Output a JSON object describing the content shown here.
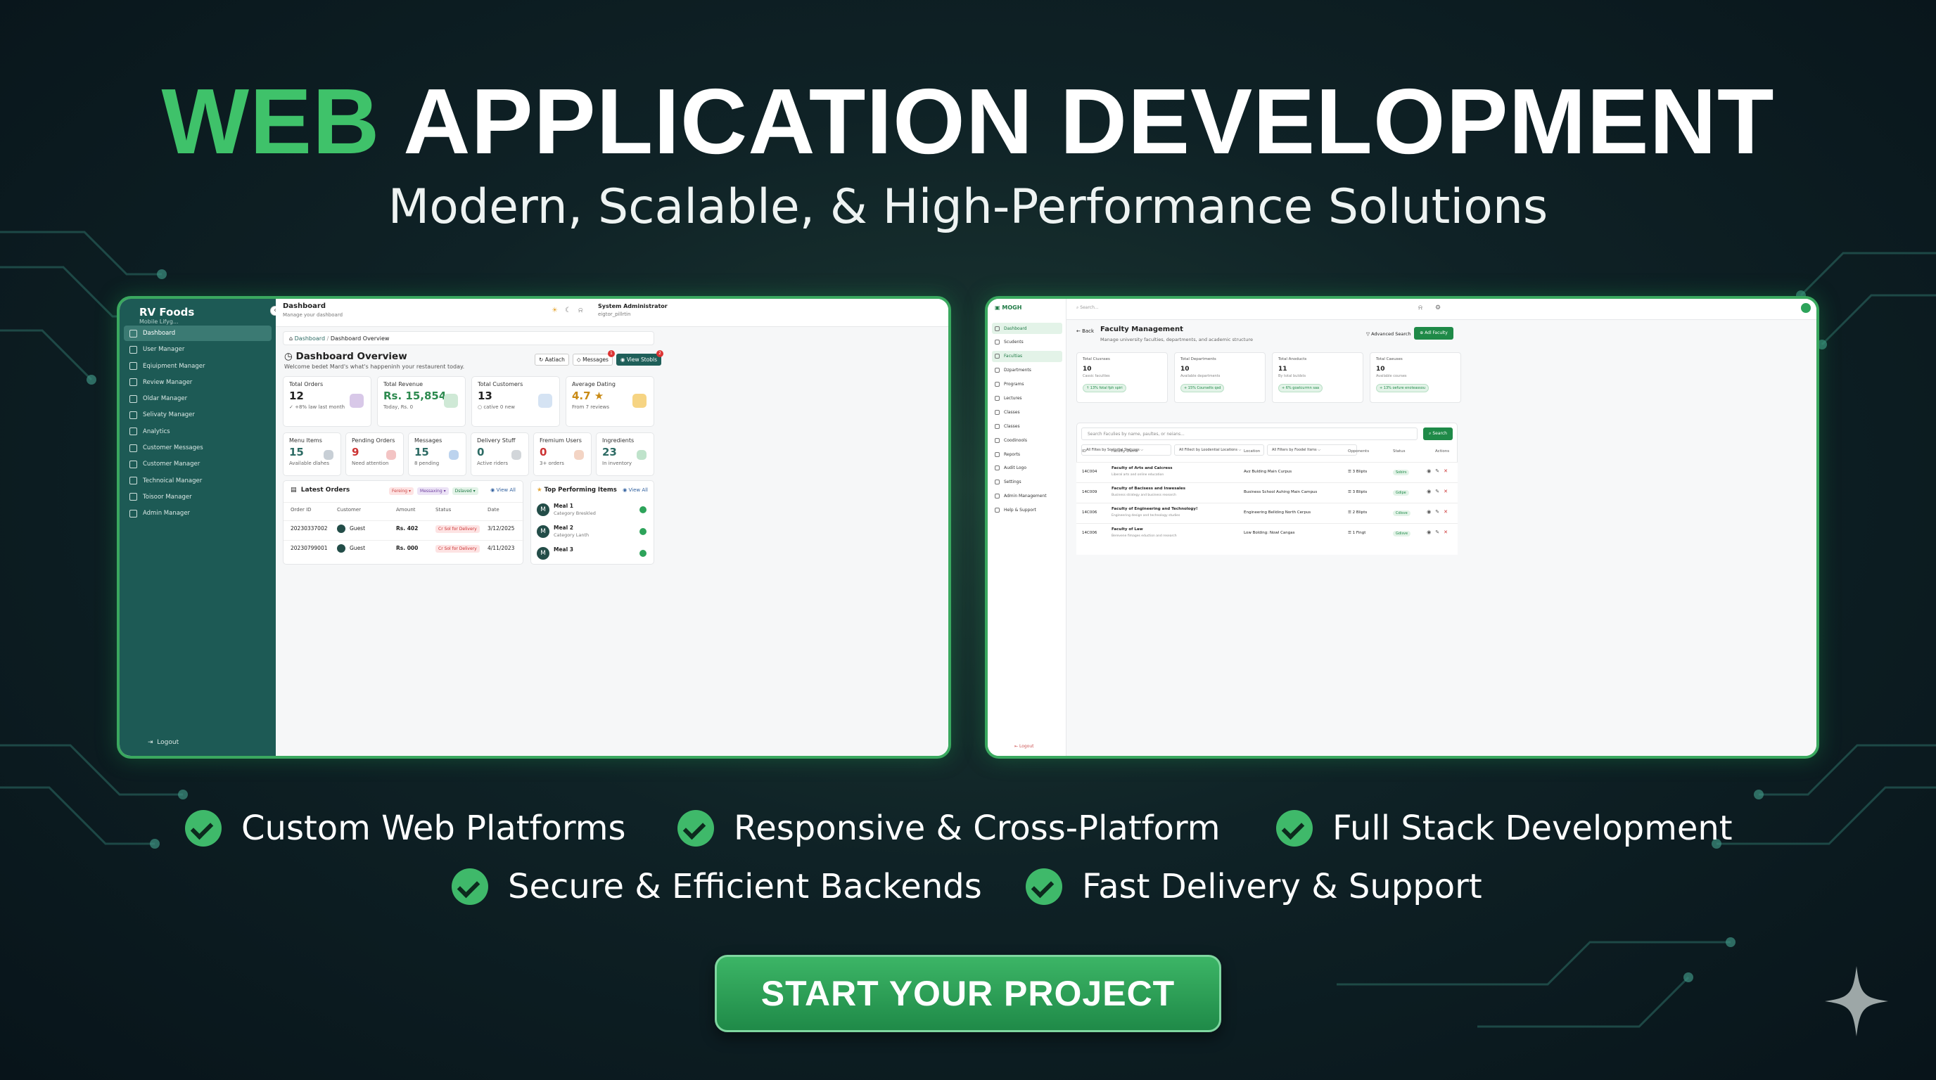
{
  "hero": {
    "title_green": "WEB",
    "title_white": "APPLICATION DEVELOPMENT",
    "subtitle": "Modern, Scalable, & High-Performance Solutions"
  },
  "dashboard": {
    "brand_name": "RV Foods",
    "brand_tag": "Mobile Lifyg...",
    "collapse_icon": "chevron-left-icon",
    "sidebar": [
      {
        "label": "Dashboard",
        "icon": "grid-icon"
      },
      {
        "label": "User Manager",
        "icon": "user-icon"
      },
      {
        "label": "Eqiuipment Manager",
        "icon": "star-icon"
      },
      {
        "label": "Review Manager",
        "icon": "star-icon"
      },
      {
        "label": "Oldar Manager",
        "icon": "cart-icon"
      },
      {
        "label": "Selivaty Manager",
        "icon": "box-icon"
      },
      {
        "label": "Analytics",
        "icon": "bar-chart-icon"
      },
      {
        "label": "Customer Messages",
        "icon": "chat-icon"
      },
      {
        "label": "Customer Manager",
        "icon": "user-icon"
      },
      {
        "label": "Technoical Manager",
        "icon": "user-icon"
      },
      {
        "label": "Toisoor Manager",
        "icon": "gear-icon"
      },
      {
        "label": "Admin Manager",
        "icon": "user-icon"
      }
    ],
    "logout": "Logout",
    "header_title": "Dashboard",
    "header_sub": "Manage your dashboard",
    "user_name": "System Administrator",
    "user_role": "eigtor_pillrtin",
    "crumb_home": "Dashboard",
    "crumb_sep": "/",
    "crumb_current": "Dashboard Overview",
    "overview_title": "Dashboard Overview",
    "overview_sub": "Welcome bedet Mard's what's happeninh your restaurent today.",
    "buttons": {
      "refresh": "Aatiach",
      "messages": "Messages",
      "view": "View Stobls"
    },
    "badges": {
      "messages": "1",
      "view": "2"
    },
    "stats": [
      {
        "label": "Total Orders",
        "value": "12",
        "delta": "✓ +8% law last month",
        "color": "#d8c8e8"
      },
      {
        "label": "Total Revenue",
        "value": "Rs. 15,854",
        "delta": "Today, Rs. 0",
        "color": "#cfe9d6"
      },
      {
        "label": "Total Customers",
        "value": "13",
        "delta": "○ cative   0 new",
        "color": "#d5e3f3"
      },
      {
        "label": "Average Dating",
        "value": "4.7 ★",
        "delta": "From 7 reviews",
        "color": "#f6d483"
      }
    ],
    "mini": [
      {
        "label": "Menu Items",
        "value": "15",
        "delta": "Available dlahes"
      },
      {
        "label": "Pending Orders",
        "value": "9",
        "delta": "Need attention"
      },
      {
        "label": "Messages",
        "value": "15",
        "delta": "8 pending"
      },
      {
        "label": "Delivery Stuff",
        "value": "0",
        "delta": "Active riders"
      },
      {
        "label": "Fremium Users",
        "value": "0",
        "delta": "3+ orders"
      },
      {
        "label": "Ingredients",
        "value": "23",
        "delta": "In inventory"
      }
    ],
    "latest_title": "Latest Orders",
    "latest_chips": [
      "Fereing ▾",
      "Messaxing ▾",
      "Dslaved ▾"
    ],
    "view_all": "View All",
    "columns": [
      "Order ID",
      "Customer",
      "Amount",
      "Status",
      "Date"
    ],
    "orders": [
      {
        "id": "20230337002",
        "customer": "Guest",
        "amount": "Rs. 402",
        "status": "Cr Sol for Delivery",
        "date": "3/12/2025"
      },
      {
        "id": "20230799001",
        "customer": "Guest",
        "amount": "Rs. 000",
        "status": "Cr Sol for Delivery",
        "date": "4/11/2023"
      }
    ],
    "top_title": "Top Performing Items",
    "top_items": [
      {
        "name": "Meal 1",
        "cat": "Category Breskled"
      },
      {
        "name": "Meal 2",
        "cat": "Category Lanth"
      },
      {
        "name": "Meal 3",
        "cat": ""
      }
    ]
  },
  "faculty": {
    "logo": "MOGH",
    "search_placeholder": "Search...",
    "sidebar": [
      "Dashboard",
      "Scudents",
      "Facultias",
      "Dzpartments",
      "Programs",
      "Lectures",
      "Classes",
      "Classes",
      "Coodinools",
      "Reports",
      "Audit Logo",
      "Settings",
      "Admin Management",
      "Help & Support"
    ],
    "logout": "Logout",
    "back": "←  Back",
    "title": "Faculty Management",
    "sub": "Manage university faculties, departments, and academic structure",
    "advanced": "▽  Advanced Search",
    "add": "⊕  Adl Faculty",
    "cards": [
      {
        "label": "Total Ciusnses",
        "value": "10",
        "desc": "Cassic faculties",
        "tag": "↑ 13% fotal fph spiri"
      },
      {
        "label": "Total Departments",
        "value": "10",
        "desc": "Available departments",
        "tag": "+ 15% Courselts qsd"
      },
      {
        "label": "Total Anoducts",
        "value": "11",
        "desc": "By total buldsts",
        "tag": "+ 6% goatcurrnn saa"
      },
      {
        "label": "Total Caeuses",
        "value": "10",
        "desc": "Available courses",
        "tag": "+ 13% oefure enoteassou"
      }
    ],
    "search_input": "Search Faculies by name, paultes, or neians...",
    "search_btn": "⌕ Search",
    "filters": [
      "All Filtes by Soclodial Statuses ⌵",
      "All Fillect by Loodential Locations ⌵",
      "All Filters by Foodel Itsms ⌵"
    ],
    "columns": [
      "ID",
      "Faculty Dame",
      "Location",
      "Opponents",
      "Status",
      "Actions"
    ],
    "rows": [
      {
        "id": "14C004",
        "name": "Faculty of Arts and Caicress",
        "desc": "Liberal arts and online education",
        "loc": "Avz Bulding Main Curpus",
        "count": "3 Blipts",
        "status": "Sobirs"
      },
      {
        "id": "14C009",
        "name": "Faculty of Bacisess and Inwesales",
        "desc": "Business strategy and business research",
        "loc": "Business School Auhing Main Campus",
        "count": "3 Blipts",
        "status": "Gdipe"
      },
      {
        "id": "14C006",
        "name": "Faculty of Engineering and Technology!",
        "desc": "Engineering design and technology studies",
        "loc": "Engineering Bellding North Cerpus",
        "count": "2 Blipts",
        "status": "Cdisve"
      },
      {
        "id": "14C006",
        "name": "Faculty of Law",
        "desc": "Berevene fimages eduction and research",
        "loc": "Low Bolding: Nowl Cangas",
        "count": "1 Fingt",
        "status": "Gdisve"
      }
    ]
  },
  "features": {
    "row1": [
      "Custom Web Platforms",
      "Responsive & Cross-Platform",
      "Full Stack Development"
    ],
    "row2": [
      "Secure & Efficient Backends",
      "Fast Delivery & Support"
    ]
  },
  "cta": "START YOUR PROJECT",
  "colors": {
    "accent": "#3fc26a",
    "panel_border": "#3aa85f",
    "sidebar": "#1d5a55",
    "button": "#1f8a48"
  }
}
